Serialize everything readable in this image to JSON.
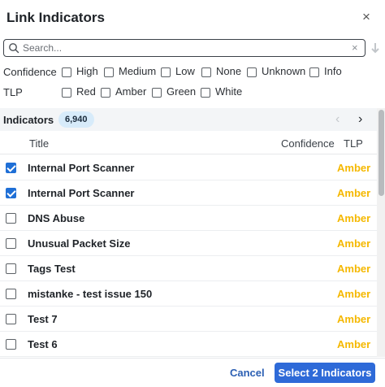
{
  "dialog": {
    "title": "Link Indicators",
    "close_glyph": "×"
  },
  "search": {
    "placeholder": "Search...",
    "clear_glyph": "×",
    "value": ""
  },
  "filters": {
    "confidence": {
      "label": "Confidence",
      "options": [
        "High",
        "Medium",
        "Low",
        "None",
        "Unknown",
        "Info"
      ]
    },
    "tlp": {
      "label": "TLP",
      "options": [
        "Red",
        "Amber",
        "Green",
        "White"
      ]
    }
  },
  "indicators": {
    "label": "Indicators",
    "count": "6,940",
    "prev_glyph": "‹",
    "next_glyph": "›"
  },
  "columns": {
    "title": "Title",
    "confidence": "Confidence",
    "tlp": "TLP"
  },
  "rows": [
    {
      "title": "Internal Port Scanner",
      "tlp": "Amber",
      "checked": true
    },
    {
      "title": "Internal Port Scanner",
      "tlp": "Amber",
      "checked": true
    },
    {
      "title": "DNS Abuse",
      "tlp": "Amber",
      "checked": false
    },
    {
      "title": "Unusual Packet Size",
      "tlp": "Amber",
      "checked": false
    },
    {
      "title": "Tags Test",
      "tlp": "Amber",
      "checked": false
    },
    {
      "title": "mistanke - test issue 150",
      "tlp": "Amber",
      "checked": false
    },
    {
      "title": "Test 7",
      "tlp": "Amber",
      "checked": false
    },
    {
      "title": "Test 6",
      "tlp": "Amber",
      "checked": false
    }
  ],
  "footer": {
    "cancel_label": "Cancel",
    "confirm_label": "Select 2 Indicators"
  },
  "colors": {
    "accent": "#2e6ad8",
    "checkbox_checked": "#1f6fd6",
    "tlp_amber": "#f5b800",
    "badge_bg": "#d7ebfa"
  },
  "icons": {
    "search": "search-icon",
    "close": "close-icon",
    "clear": "clear-icon",
    "sort_down": "arrow-down-icon",
    "prev": "chevron-left-icon",
    "next": "chevron-right-icon"
  }
}
